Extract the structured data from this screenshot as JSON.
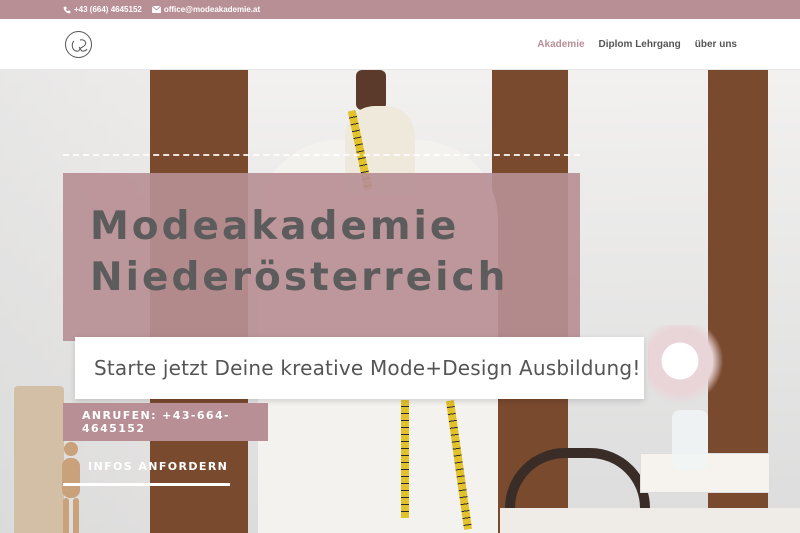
{
  "topbar": {
    "phone": "+43 (664) 4645152",
    "email": "office@modeakademie.at",
    "phone_icon": "phone-icon",
    "email_icon": "envelope-icon"
  },
  "header": {
    "logo": "logo-icon",
    "nav": [
      {
        "label": "Akademie",
        "active": true
      },
      {
        "label": "Diplom Lehrgang",
        "active": false
      },
      {
        "label": "über uns",
        "active": false
      }
    ]
  },
  "hero": {
    "title_line1": "Modeakademie",
    "title_line2": "Niederösterreich",
    "subtitle": "Starte jetzt Deine kreative Mode+Design Ausbildung!",
    "call_button": "ANRUFEN: +43-664-4645152",
    "info_button": "INFOS ANFORDERN"
  },
  "colors": {
    "accent": "#b88f95",
    "title_text": "#5c5c5c",
    "nav_text": "#555555"
  }
}
